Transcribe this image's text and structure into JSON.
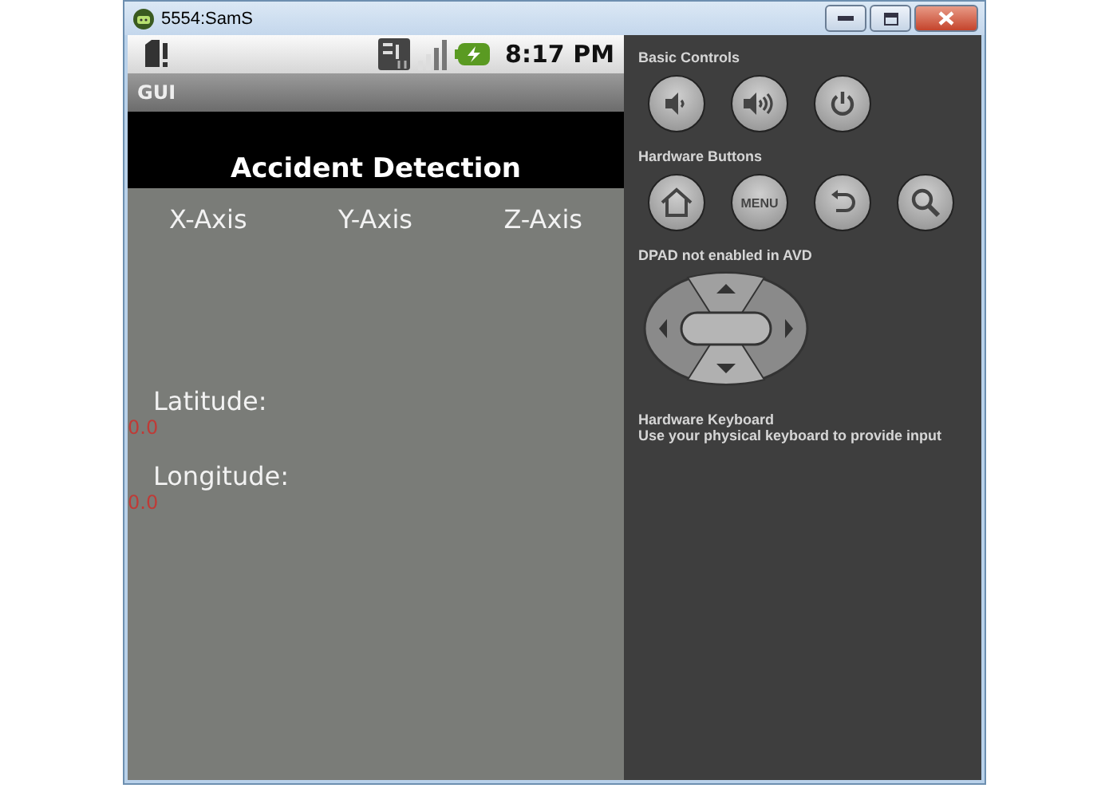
{
  "window": {
    "title": "5554:SamS"
  },
  "status_bar": {
    "time": "8:17 PM"
  },
  "app_bar": {
    "title": "GUI"
  },
  "heading": "Accident Detection",
  "axes": [
    "X-Axis",
    "Y-Axis",
    "Z-Axis"
  ],
  "fields": [
    {
      "label": "Latitude:",
      "value": "0.0"
    },
    {
      "label": "Longitude:",
      "value": "0.0"
    }
  ],
  "controls": {
    "basic_title": "Basic Controls",
    "hardware_title": "Hardware Buttons",
    "menu_label": "MENU",
    "dpad_label": "**DPAD** not enabled in AVD",
    "keyboard_title": "Hardware Keyboard",
    "keyboard_hint": "Use your physical keyboard to provide input"
  }
}
